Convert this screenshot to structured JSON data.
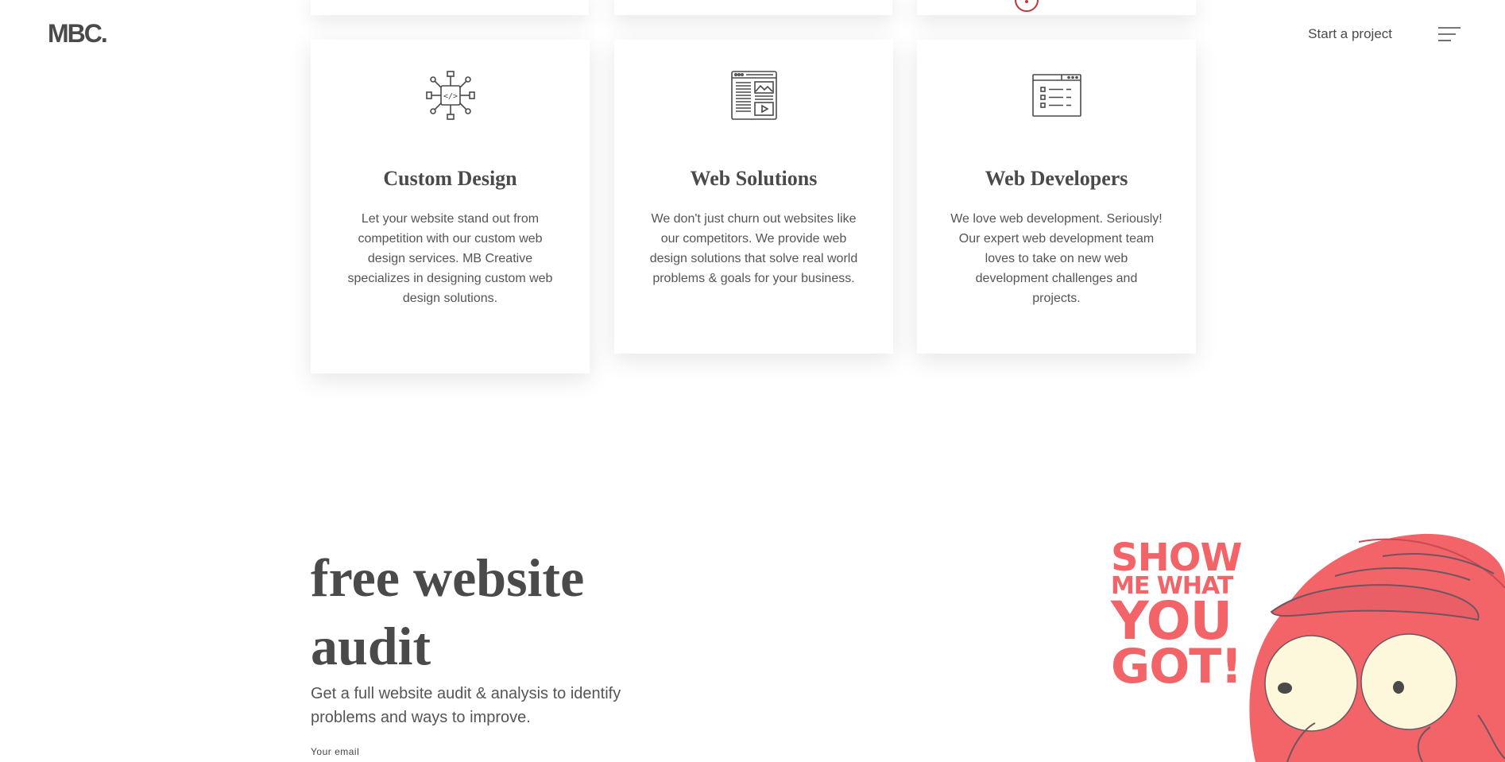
{
  "header": {
    "logo": "MBC.",
    "start_project": "Start a project"
  },
  "cards": [
    {
      "title": "Custom Design",
      "text": "Let your website stand out from competition with our custom web design services. MB Creative specializes in designing custom web design solutions.",
      "icon": "network-code-icon"
    },
    {
      "title": "Web Solutions",
      "text": "We don't just churn out websites like our competitors. We provide web design solutions that solve real world problems & goals for your business.",
      "icon": "browser-layout-icon"
    },
    {
      "title": "Web Developers",
      "text": "We love web development. Seriously! Our expert web development team loves to take on new web development challenges and projects.",
      "icon": "browser-checklist-icon"
    }
  ],
  "audit": {
    "title": "free website audit",
    "subtitle": "Get a full website audit & analysis to identify problems and ways to improve.",
    "email_label": "Your email"
  },
  "illustration": {
    "slogan_line1": "SHOW",
    "slogan_line2": "ME WHAT",
    "slogan_line3": "YOU",
    "slogan_line4": "GOT!",
    "accent_color": "#f26467",
    "eye_color": "#fdf8dc"
  }
}
